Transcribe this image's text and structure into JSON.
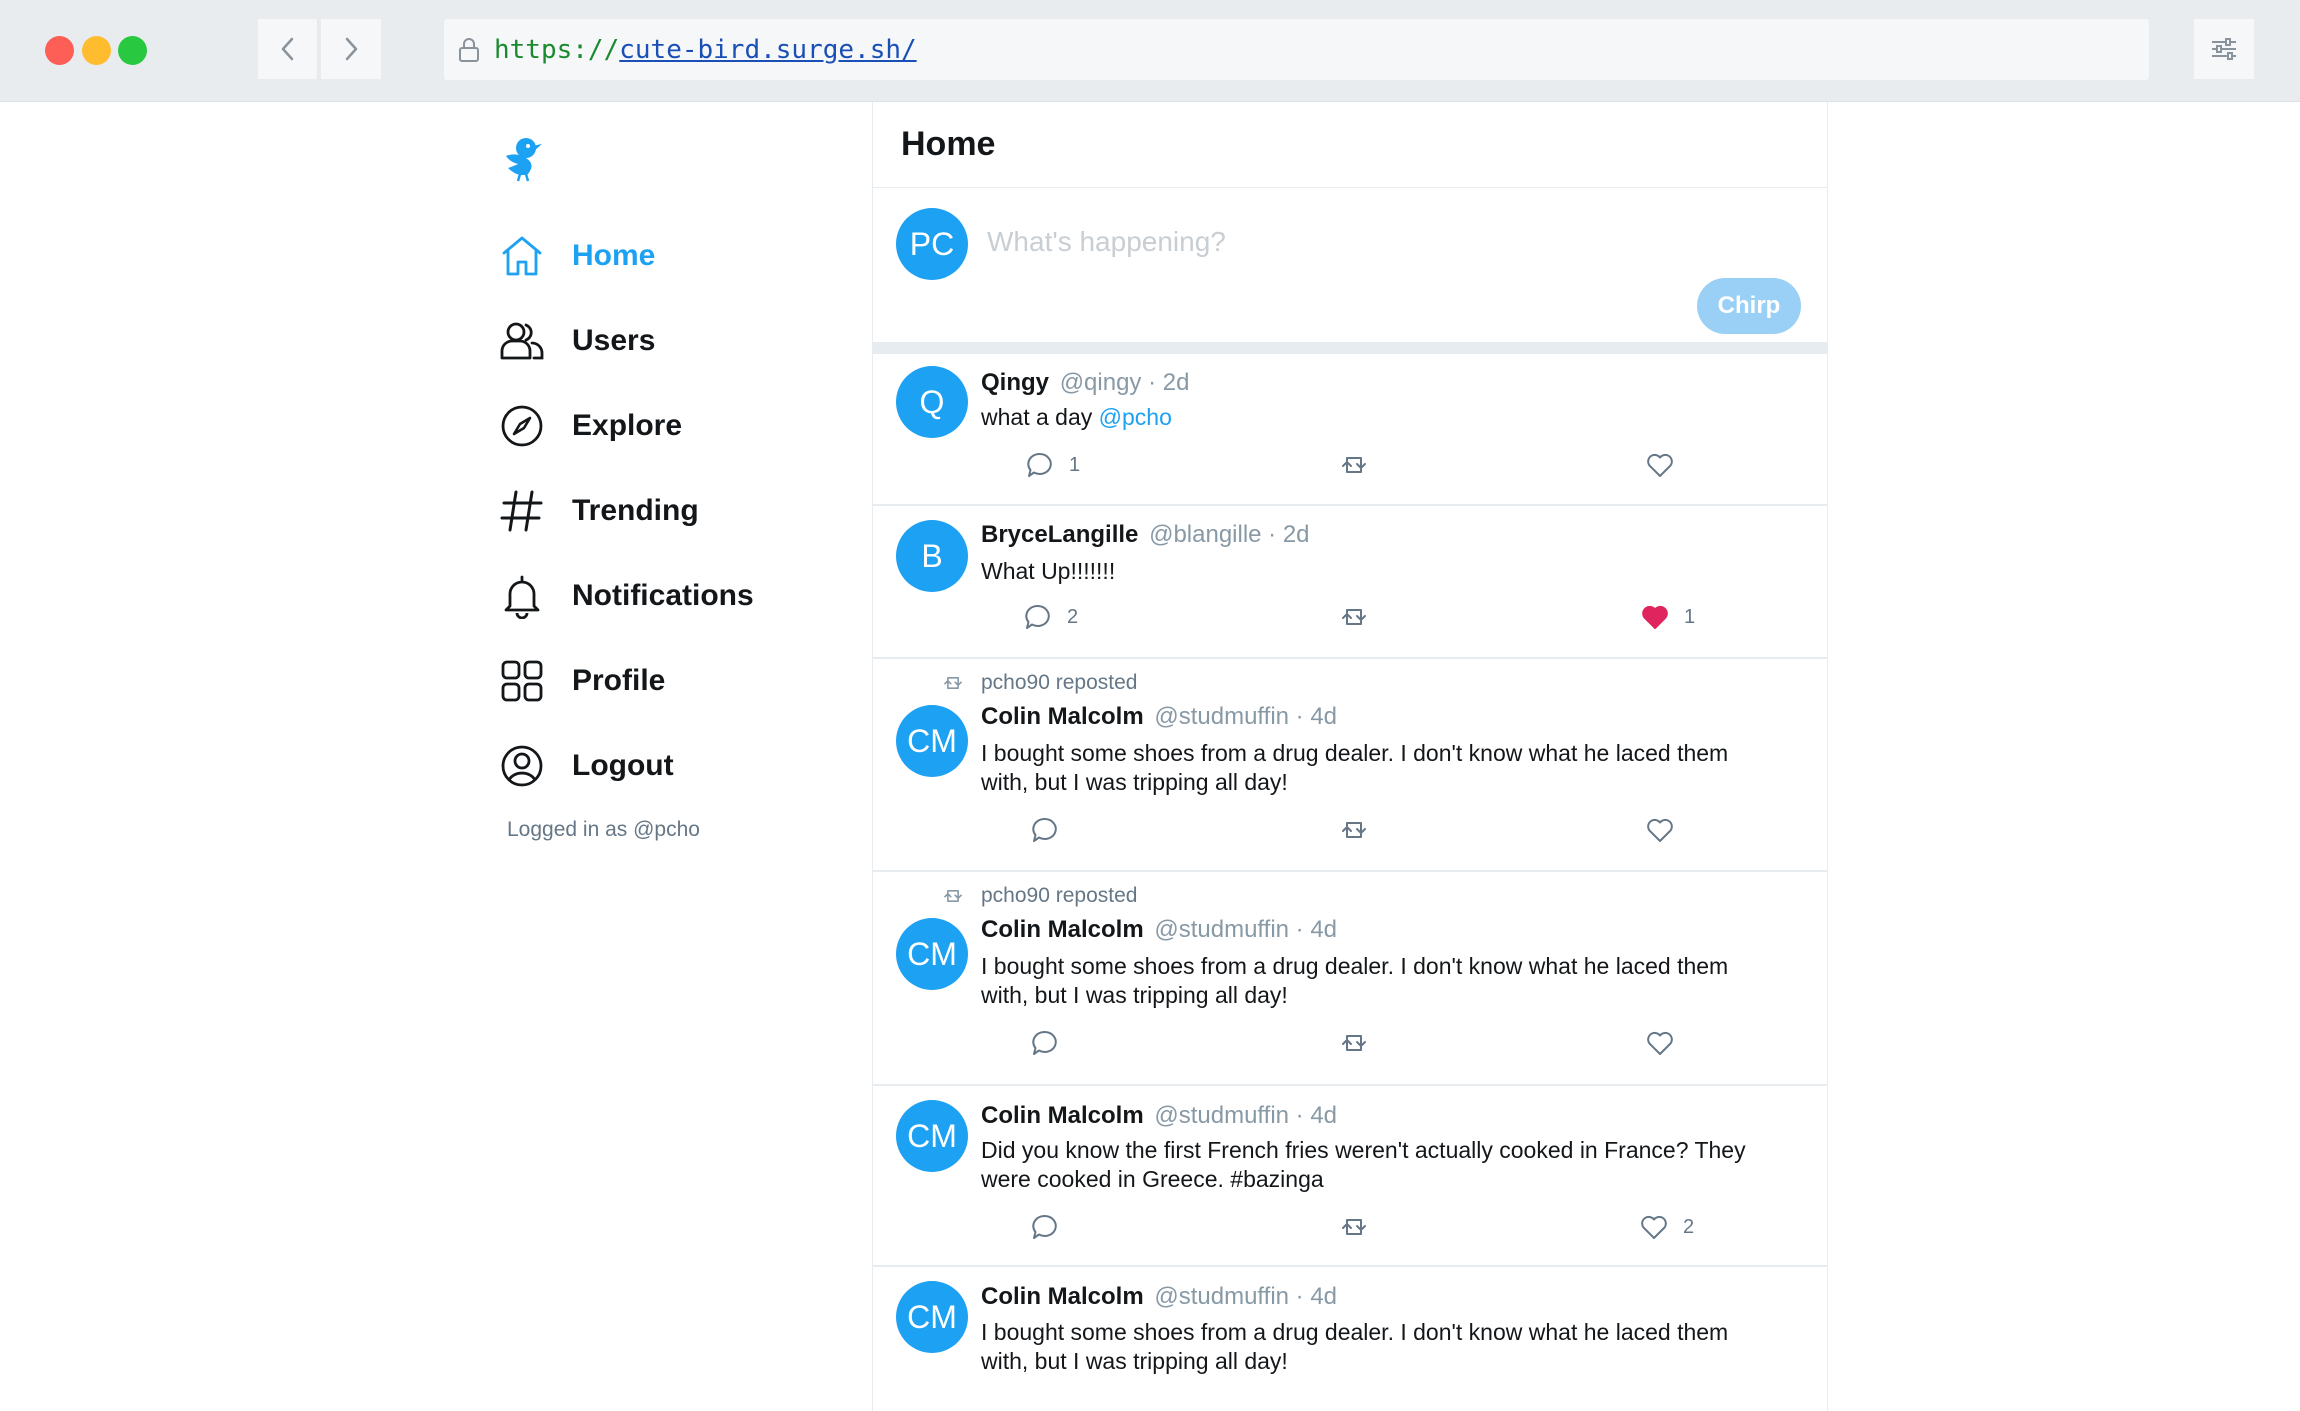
{
  "browser": {
    "url_protocol": "https://",
    "url_host": "cute-bird.surge.sh/"
  },
  "sidebar": {
    "logo": "bird-logo",
    "items": [
      {
        "label": "Home",
        "icon": "home-icon",
        "active": true
      },
      {
        "label": "Users",
        "icon": "users-icon",
        "active": false
      },
      {
        "label": "Explore",
        "icon": "compass-icon",
        "active": false
      },
      {
        "label": "Trending",
        "icon": "hashtag-icon",
        "active": false
      },
      {
        "label": "Notifications",
        "icon": "bell-icon",
        "active": false
      },
      {
        "label": "Profile",
        "icon": "grid-icon",
        "active": false
      },
      {
        "label": "Logout",
        "icon": "user-circle-icon",
        "active": false
      }
    ],
    "logged_in_text": "Logged in as @pcho"
  },
  "main": {
    "title": "Home",
    "composer": {
      "avatar_initials": "PC",
      "placeholder": "What's happening?",
      "button_label": "Chirp"
    },
    "tweets": [
      {
        "initials": "Q",
        "name": "Qingy",
        "meta": "@qingy · 2d",
        "text": "what a day ",
        "mention": "@pcho",
        "reply_count": "1",
        "like_count": "",
        "liked": false
      },
      {
        "initials": "B",
        "name": "BryceLangille",
        "meta": "@blangille · 2d",
        "text": "What Up!!!!!!!",
        "mention": "",
        "reply_count": "2",
        "like_count": "1",
        "liked": true
      },
      {
        "repost_text": "pcho90 reposted",
        "initials": "CM",
        "name": "Colin Malcolm",
        "meta": "@studmuffin · 4d",
        "text": "I bought some shoes from a drug dealer. I don't know what he laced them with, but I was tripping all day!",
        "mention": "",
        "reply_count": "",
        "like_count": "",
        "liked": false
      },
      {
        "repost_text": "pcho90 reposted",
        "initials": "CM",
        "name": "Colin Malcolm",
        "meta": "@studmuffin · 4d",
        "text": "I bought some shoes from a drug dealer. I don't know what he laced them with, but I was tripping all day!",
        "mention": "",
        "reply_count": "",
        "like_count": "",
        "liked": false
      },
      {
        "initials": "CM",
        "name": "Colin Malcolm",
        "meta": "@studmuffin · 4d",
        "text": "Did you know the first French fries weren't actually cooked in France? They were cooked in Greece. #bazinga",
        "mention": "",
        "reply_count": "",
        "like_count": "2",
        "liked": false
      },
      {
        "initials": "CM",
        "name": "Colin Malcolm",
        "meta": "@studmuffin · 4d",
        "text": "I bought some shoes from a drug dealer. I don't know what he laced them with, but I was tripping all day!",
        "mention": "",
        "reply_count": "",
        "like_count": "",
        "liked": false
      }
    ]
  },
  "colors": {
    "accent": "#1da1f2",
    "like": "#e0245e",
    "muted": "#657786"
  }
}
